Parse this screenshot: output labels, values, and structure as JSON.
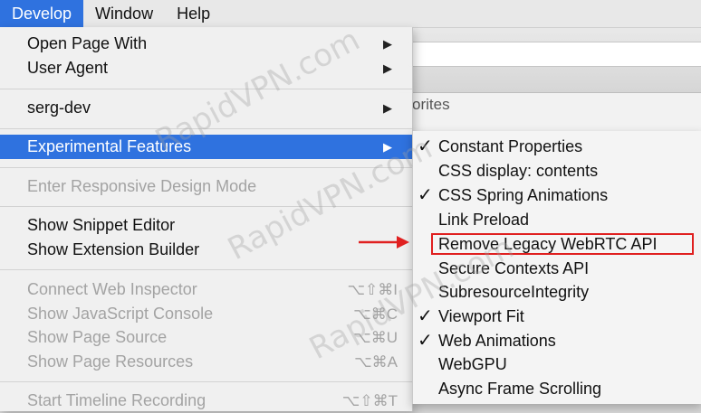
{
  "menubar": {
    "items": [
      {
        "label": "Develop",
        "active": true
      },
      {
        "label": "Window",
        "active": false
      },
      {
        "label": "Help",
        "active": false
      }
    ]
  },
  "background": {
    "favorites_partial": "orites"
  },
  "menu": {
    "open_page_with": "Open Page With",
    "user_agent": "User Agent",
    "serg_dev": "serg-dev",
    "experimental_features": "Experimental Features",
    "enter_responsive": "Enter Responsive Design Mode",
    "show_snippet_editor": "Show Snippet Editor",
    "show_extension_builder": "Show Extension Builder",
    "connect_web_inspector": "Connect Web Inspector",
    "connect_web_inspector_shortcut": "⌥⇧⌘I",
    "show_js_console": "Show JavaScript Console",
    "show_js_console_shortcut": "⌥⌘C",
    "show_page_source": "Show Page Source",
    "show_page_source_shortcut": "⌥⌘U",
    "show_page_resources": "Show Page Resources",
    "show_page_resources_shortcut": "⌥⌘A",
    "start_timeline": "Start Timeline Recording",
    "start_timeline_shortcut": "⌥⇧⌘T",
    "arrow_glyph": "▶"
  },
  "submenu": {
    "check_glyph": "✓",
    "items": [
      {
        "label": "Constant Properties",
        "checked": true
      },
      {
        "label": "CSS display: contents",
        "checked": false
      },
      {
        "label": "CSS Spring Animations",
        "checked": true
      },
      {
        "label": "Link Preload",
        "checked": false
      },
      {
        "label": "Remove Legacy WebRTC API",
        "checked": false
      },
      {
        "label": "Secure Contexts API",
        "checked": false
      },
      {
        "label": "SubresourceIntegrity",
        "checked": false
      },
      {
        "label": "Viewport Fit",
        "checked": true
      },
      {
        "label": "Web Animations",
        "checked": true
      },
      {
        "label": "WebGPU",
        "checked": false
      },
      {
        "label": "Async Frame Scrolling",
        "checked": false
      }
    ]
  },
  "watermark": "RapidVPN.com",
  "colors": {
    "selection": "#2f72df",
    "annotation": "#e02020"
  }
}
